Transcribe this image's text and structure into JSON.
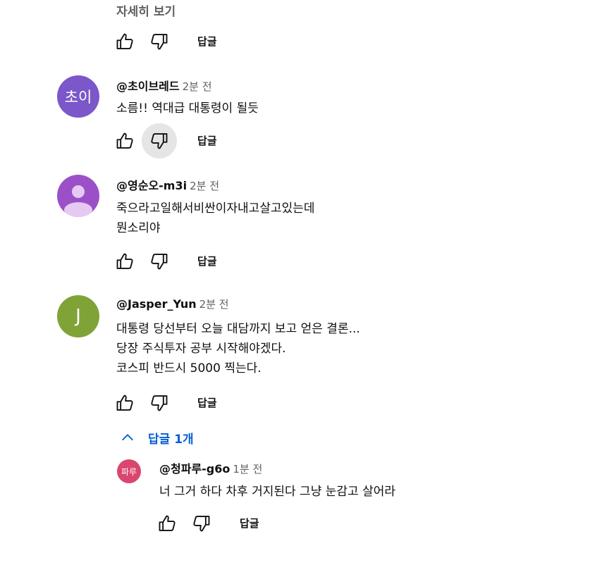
{
  "top": {
    "more_label": "자세히 보기",
    "reply_label": "답글"
  },
  "comments": [
    {
      "avatar_text": "초이",
      "avatar_color": "#7b57c9",
      "author": "@초이브레드",
      "time": "2분 전",
      "lines": [
        "소름!! 역대급 대통령이 될듯"
      ],
      "reply_label": "답글",
      "dislike_active": true
    },
    {
      "avatar_text": "",
      "avatar_color": "#9b50c8",
      "author": "@영순오-m3i",
      "time": "2분 전",
      "lines": [
        "죽으라고일해서비싼이자내고살고있는데",
        "뭔소리야"
      ],
      "reply_label": "답글"
    },
    {
      "avatar_text": "J",
      "avatar_color": "#7fa336",
      "author": "@Jasper_Yun",
      "time": "2분 전",
      "lines": [
        "대통령 당선부터 오늘 대담까지 보고 얻은 결론...",
        "당장 주식투자 공부 시작해야겠다.",
        "코스피 반드시 5000 찍는다."
      ],
      "reply_label": "답글",
      "replies_toggle_label": "답글 1개"
    }
  ],
  "reply": {
    "avatar_text": "파루",
    "avatar_color": "#d9466e",
    "author": "@청파루-g6o",
    "time": "1분 전",
    "text": "너 그거 하다 차후 거지된다 그냥 눈감고 살어라",
    "reply_label": "답글"
  },
  "icons": {
    "like": "thumbs-up-icon",
    "dislike": "thumbs-down-icon",
    "collapse": "chevron-up-icon",
    "default_avatar": "person-icon"
  },
  "colors": {
    "link_blue": "#065fd4",
    "secondary_text": "#606060",
    "active_button_bg": "#e5e5e5"
  }
}
